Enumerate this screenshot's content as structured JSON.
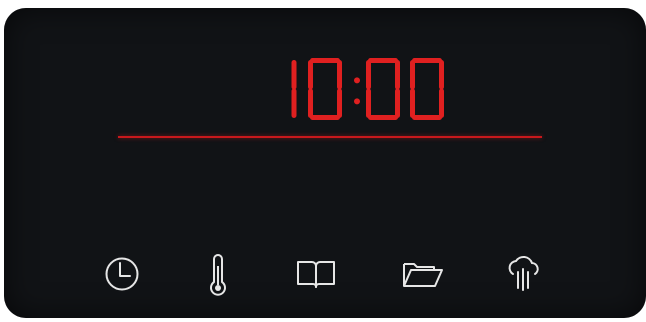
{
  "display": {
    "time": "10:00",
    "digit_color": "#e02020"
  },
  "panel": {
    "background": "#111316",
    "line_color": "#c8181c",
    "icon_color": "#e6e6e6"
  },
  "controls": [
    {
      "id": "clock",
      "icon": "clock-icon"
    },
    {
      "id": "temperature",
      "icon": "thermometer-icon"
    },
    {
      "id": "recipes",
      "icon": "book-icon"
    },
    {
      "id": "programs",
      "icon": "folder-icon"
    },
    {
      "id": "steam",
      "icon": "steam-icon"
    }
  ]
}
